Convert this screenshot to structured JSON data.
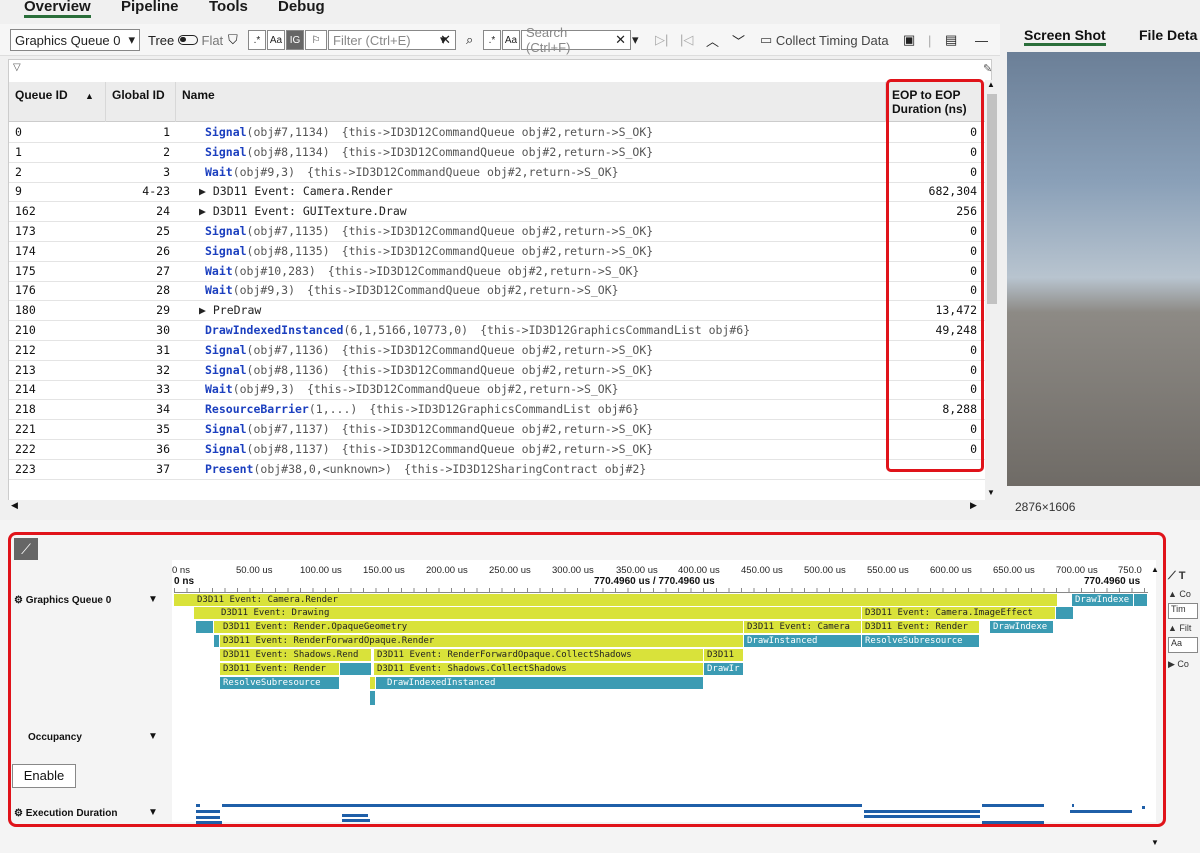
{
  "menu": {
    "overview": "Overview",
    "pipeline": "Pipeline",
    "tools": "Tools",
    "debug": "Debug"
  },
  "toolbar": {
    "queue_select": "Graphics Queue 0",
    "tree": "Tree",
    "flat": "Flat",
    "regex1": ".*",
    "case1": "Aa",
    "ig": "IG",
    "filter_placeholder": "Filter (Ctrl+E)",
    "regex2": ".*",
    "case2": "Aa",
    "search_placeholder": "Search (Ctrl+F)",
    "collect": "Collect Timing Data"
  },
  "right_tabs": {
    "screenshot": "Screen Shot",
    "file_details": "File Deta"
  },
  "screenshot_size": "2876×1606",
  "grid": {
    "columns": {
      "queue_id": "Queue ID",
      "global_id": "Global ID",
      "name": "Name",
      "eop": "EOP to EOP",
      "eop2": "Duration (ns)"
    },
    "rows": [
      {
        "q": "0",
        "g": "1",
        "fn": "Signal",
        "args": "(obj#7,1134)",
        "ctx": "{this->ID3D12CommandQueue obj#2,return->S_OK}",
        "d": "0"
      },
      {
        "q": "1",
        "g": "2",
        "fn": "Signal",
        "args": "(obj#8,1134)",
        "ctx": "{this->ID3D12CommandQueue obj#2,return->S_OK}",
        "d": "0"
      },
      {
        "q": "2",
        "g": "3",
        "fn": "Wait",
        "args": "(obj#9,3)",
        "ctx": "{this->ID3D12CommandQueue obj#2,return->S_OK}",
        "d": "0"
      },
      {
        "q": "9",
        "g": "4-23",
        "ev": "▶ D3D11 Event: Camera.Render",
        "d": "682,304"
      },
      {
        "q": "162",
        "g": "24",
        "ev": "▶ D3D11 Event: GUITexture.Draw",
        "d": "256"
      },
      {
        "q": "173",
        "g": "25",
        "fn": "Signal",
        "args": "(obj#7,1135)",
        "ctx": "{this->ID3D12CommandQueue obj#2,return->S_OK}",
        "d": "0"
      },
      {
        "q": "174",
        "g": "26",
        "fn": "Signal",
        "args": "(obj#8,1135)",
        "ctx": "{this->ID3D12CommandQueue obj#2,return->S_OK}",
        "d": "0"
      },
      {
        "q": "175",
        "g": "27",
        "fn": "Wait",
        "args": "(obj#10,283)",
        "ctx": "{this->ID3D12CommandQueue obj#2,return->S_OK}",
        "d": "0"
      },
      {
        "q": "176",
        "g": "28",
        "fn": "Wait",
        "args": "(obj#9,3)",
        "ctx": "{this->ID3D12CommandQueue obj#2,return->S_OK}",
        "d": "0"
      },
      {
        "q": "180",
        "g": "29",
        "ev": "▶ PreDraw",
        "d": "13,472"
      },
      {
        "q": "210",
        "g": "30",
        "fn": "DrawIndexedInstanced",
        "args": "(6,1,5166,10773,0)",
        "ctx": "{this->ID3D12GraphicsCommandList obj#6}",
        "d": "49,248"
      },
      {
        "q": "212",
        "g": "31",
        "fn": "Signal",
        "args": "(obj#7,1136)",
        "ctx": "{this->ID3D12CommandQueue obj#2,return->S_OK}",
        "d": "0"
      },
      {
        "q": "213",
        "g": "32",
        "fn": "Signal",
        "args": "(obj#8,1136)",
        "ctx": "{this->ID3D12CommandQueue obj#2,return->S_OK}",
        "d": "0"
      },
      {
        "q": "214",
        "g": "33",
        "fn": "Wait",
        "args": "(obj#9,3)",
        "ctx": "{this->ID3D12CommandQueue obj#2,return->S_OK}",
        "d": "0"
      },
      {
        "q": "218",
        "g": "34",
        "fn": "ResourceBarrier",
        "args": "(1,...)",
        "ctx": "{this->ID3D12GraphicsCommandList obj#6}",
        "d": "8,288"
      },
      {
        "q": "221",
        "g": "35",
        "fn": "Signal",
        "args": "(obj#7,1137)",
        "ctx": "{this->ID3D12CommandQueue obj#2,return->S_OK}",
        "d": "0"
      },
      {
        "q": "222",
        "g": "36",
        "fn": "Signal",
        "args": "(obj#8,1137)",
        "ctx": "{this->ID3D12CommandQueue obj#2,return->S_OK}",
        "d": "0"
      },
      {
        "q": "223",
        "g": "37",
        "fn": "Present",
        "args": "(obj#38,0,<unknown>)",
        "ctx": "{this->ID3D12SharingContract obj#2}",
        "d": ""
      }
    ]
  },
  "timeline": {
    "ticks": [
      "0 ns",
      "50.00 us",
      "100.00 us",
      "150.00 us",
      "200.00 us",
      "250.00 us",
      "300.00 us",
      "350.00 us",
      "400.00 us",
      "450.00 us",
      "500.00 us",
      "550.00 us",
      "600.00 us",
      "650.00 us",
      "700.00 us",
      "750.0"
    ],
    "start_label": "0 ns",
    "cursor_label": "770.4960 us / 770.4960 us",
    "end_label": "770.4960 us",
    "tracks": {
      "gq": "Graphics Queue 0",
      "occ": "Occupancy",
      "exec": "Execution Duration"
    },
    "enable": "Enable",
    "bars": {
      "b1": "D3D11 Event: Camera.Render",
      "b2": "DrawIndexe",
      "b3": "D3D11 Event: Drawing",
      "b4": "D3D11 Event: Camera.ImageEffect",
      "b5": "D3D11 Event: Render.OpaqueGeometry",
      "b6": "D3D11 Event: Camera",
      "b7": "D3D11 Event: Render",
      "b8": "DrawIndexe",
      "b9": "D3D11 Event: RenderForwardOpaque.Render",
      "b10": "DrawInstanced",
      "b11": "ResolveSubresource",
      "b12": "D3D11 Event: Shadows.Rend",
      "b13": "D3D11 Event: RenderForwardOpaque.CollectShadows",
      "b14": "D3D11",
      "b15": "D3D11 Event: Render",
      "b16": "D3D11 Event: Shadows.CollectShadows",
      "b17": "DrawIr",
      "b18": "ResolveSubresource",
      "b19": "DrawIndexedInstanced"
    }
  },
  "side": {
    "c1": "▲ Co",
    "c2": "Tim",
    "c3": "▲ Filt",
    "c4": "Aa",
    "c5": "▶ Co",
    "t": "T"
  }
}
